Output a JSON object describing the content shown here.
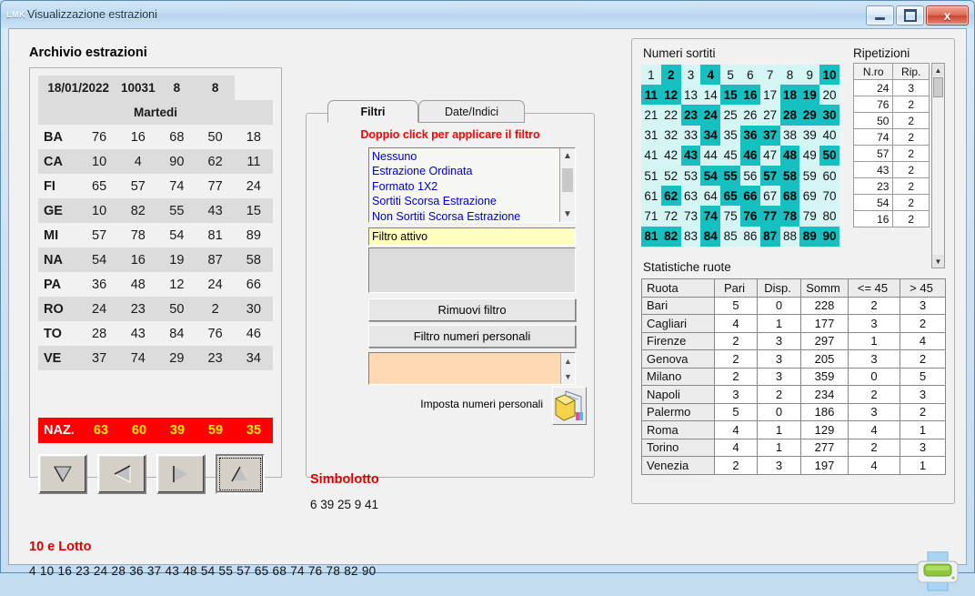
{
  "window": {
    "app_badge": "LMK",
    "title": "Visualizzazione estrazioni",
    "minimize_label": "",
    "maximize_label": "",
    "close_label": "x"
  },
  "archivio": {
    "title": "Archivio estrazioni",
    "header": {
      "date": "18/01/2022",
      "draw_number": "10031",
      "col3": "8",
      "col4": "8"
    },
    "weekday": "Martedi",
    "rows": [
      {
        "wheel": "BA",
        "numbers": [
          "76",
          "16",
          "68",
          "50",
          "18"
        ]
      },
      {
        "wheel": "CA",
        "numbers": [
          "10",
          "4",
          "90",
          "62",
          "11"
        ]
      },
      {
        "wheel": "FI",
        "numbers": [
          "65",
          "57",
          "74",
          "77",
          "24"
        ]
      },
      {
        "wheel": "GE",
        "numbers": [
          "10",
          "82",
          "55",
          "43",
          "15"
        ]
      },
      {
        "wheel": "MI",
        "numbers": [
          "57",
          "78",
          "54",
          "81",
          "89"
        ]
      },
      {
        "wheel": "NA",
        "numbers": [
          "54",
          "16",
          "19",
          "87",
          "58"
        ]
      },
      {
        "wheel": "PA",
        "numbers": [
          "36",
          "48",
          "12",
          "24",
          "66"
        ]
      },
      {
        "wheel": "RO",
        "numbers": [
          "24",
          "23",
          "50",
          "2",
          "30"
        ]
      },
      {
        "wheel": "TO",
        "numbers": [
          "28",
          "43",
          "84",
          "76",
          "46"
        ]
      },
      {
        "wheel": "VE",
        "numbers": [
          "37",
          "74",
          "29",
          "23",
          "34"
        ]
      }
    ],
    "naz": {
      "label": "NAZ.",
      "numbers": [
        "63",
        "60",
        "39",
        "59",
        "35"
      ],
      "bg": "#ff0000",
      "fg": "#ffe400"
    },
    "nav_buttons": [
      {
        "name": "first",
        "glyph": "down-triangle-icon"
      },
      {
        "name": "previous",
        "glyph": "left-triangle-icon"
      },
      {
        "name": "next",
        "glyph": "right-triangle-icon"
      },
      {
        "name": "last",
        "glyph": "up-triangle-icon"
      }
    ]
  },
  "filters": {
    "tabs": [
      {
        "label": "Filtri",
        "active": true
      },
      {
        "label": "Date/Indici",
        "active": false
      }
    ],
    "hint": "Doppio click per applicare il  filtro",
    "hint_color": "#ff0000",
    "list_items": [
      "Nessuno",
      "Estrazione Ordinata",
      "Formato 1X2",
      "Sortiti Scorsa Estrazione",
      "Non Sortiti Scorsa Estrazione"
    ],
    "active_filter_value": "Filtro attivo",
    "active_filter_bg": "#ffffc0",
    "detail_box_value": "",
    "remove_filter_label": "Rimuovi filtro",
    "personal_filter_label": "Filtro numeri personali",
    "personal_numbers_value": "",
    "personal_numbers_bg": "#ffd9b3",
    "set_personal_label": "Imposta numeri personali",
    "folder_icon": "open-folder-icon"
  },
  "simbolotto": {
    "title": "Simbolotto",
    "title_color": "#dd0000",
    "numbers": "6 39 25 9 41"
  },
  "dieci_e_lotto": {
    "title": "10 e Lotto",
    "title_color": "#dd0000",
    "numbers": "4 10 16 23 24 28 36 37 43 48 54 55 57 65 68 74 76 78 82 90"
  },
  "numeri_sortiti": {
    "title": "Numeri sortiti",
    "cell_bg": "#d5f4f4",
    "hit_bg": "#17c0c0",
    "rows": [
      [
        "1",
        "2",
        "3",
        "4",
        "5",
        "6",
        "7",
        "8",
        "9",
        "10"
      ],
      [
        "11",
        "12",
        "13",
        "14",
        "15",
        "16",
        "17",
        "18",
        "19",
        "20"
      ],
      [
        "21",
        "22",
        "23",
        "24",
        "25",
        "26",
        "27",
        "28",
        "29",
        "30"
      ],
      [
        "31",
        "32",
        "33",
        "34",
        "35",
        "36",
        "37",
        "38",
        "39",
        "40"
      ],
      [
        "41",
        "42",
        "43",
        "44",
        "45",
        "46",
        "47",
        "48",
        "49",
        "50"
      ],
      [
        "51",
        "52",
        "53",
        "54",
        "55",
        "56",
        "57",
        "58",
        "59",
        "60"
      ],
      [
        "61",
        "62",
        "63",
        "64",
        "65",
        "66",
        "67",
        "68",
        "69",
        "70"
      ],
      [
        "71",
        "72",
        "73",
        "74",
        "75",
        "76",
        "77",
        "78",
        "79",
        "80"
      ],
      [
        "81",
        "82",
        "83",
        "84",
        "85",
        "86",
        "87",
        "88",
        "89",
        "90"
      ]
    ],
    "hits": [
      2,
      4,
      10,
      11,
      12,
      15,
      16,
      18,
      19,
      23,
      24,
      28,
      29,
      30,
      34,
      36,
      37,
      43,
      46,
      48,
      50,
      54,
      55,
      57,
      58,
      62,
      65,
      66,
      68,
      74,
      76,
      77,
      78,
      81,
      82,
      84,
      87,
      89,
      90
    ]
  },
  "ripetizioni": {
    "title": "Ripetizioni",
    "columns": [
      "N.ro",
      "Rip."
    ],
    "rows": [
      [
        "24",
        "3"
      ],
      [
        "76",
        "2"
      ],
      [
        "50",
        "2"
      ],
      [
        "74",
        "2"
      ],
      [
        "57",
        "2"
      ],
      [
        "43",
        "2"
      ],
      [
        "23",
        "2"
      ],
      [
        "54",
        "2"
      ],
      [
        "16",
        "2"
      ]
    ]
  },
  "statistiche_ruote": {
    "title": "Statistiche ruote",
    "columns": [
      "Ruota",
      "Pari",
      "Disp.",
      "Somm",
      "<= 45",
      "> 45"
    ],
    "rows": [
      [
        "Bari",
        "5",
        "0",
        "228",
        "2",
        "3"
      ],
      [
        "Cagliari",
        "4",
        "1",
        "177",
        "3",
        "2"
      ],
      [
        "Firenze",
        "2",
        "3",
        "297",
        "1",
        "4"
      ],
      [
        "Genova",
        "2",
        "3",
        "205",
        "3",
        "2"
      ],
      [
        "Milano",
        "2",
        "3",
        "359",
        "0",
        "5"
      ],
      [
        "Napoli",
        "3",
        "2",
        "234",
        "2",
        "3"
      ],
      [
        "Palermo",
        "5",
        "0",
        "186",
        "3",
        "2"
      ],
      [
        "Roma",
        "4",
        "1",
        "129",
        "4",
        "1"
      ],
      [
        "Torino",
        "4",
        "1",
        "277",
        "2",
        "3"
      ],
      [
        "Venezia",
        "2",
        "3",
        "197",
        "4",
        "1"
      ]
    ]
  },
  "print": {
    "icon": "printer-icon"
  }
}
